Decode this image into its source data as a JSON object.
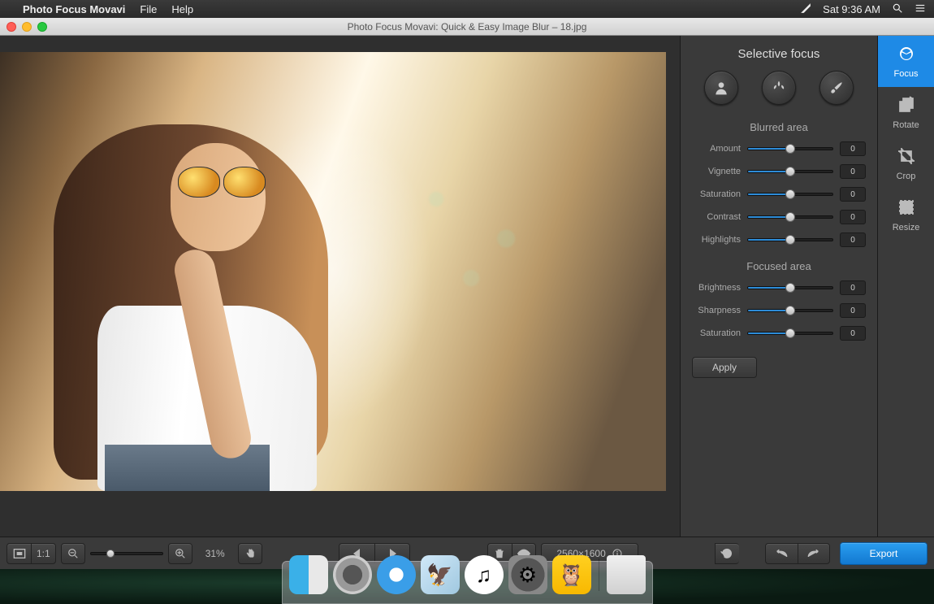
{
  "menubar": {
    "app_name": "Photo Focus Movavi",
    "items": [
      "File",
      "Help"
    ],
    "clock": "Sat 9:36 AM"
  },
  "window": {
    "title": "Photo Focus Movavi: Quick & Easy Image Blur – 18.jpg"
  },
  "panel": {
    "title": "Selective focus",
    "blurred_title": "Blurred area",
    "focused_title": "Focused area",
    "blurred": [
      {
        "label": "Amount",
        "value": 0,
        "pos": 50
      },
      {
        "label": "Vignette",
        "value": 0,
        "pos": 50
      },
      {
        "label": "Saturation",
        "value": 0,
        "pos": 50
      },
      {
        "label": "Contrast",
        "value": 0,
        "pos": 50
      },
      {
        "label": "Highlights",
        "value": 0,
        "pos": 50
      }
    ],
    "focused": [
      {
        "label": "Brightness",
        "value": 0,
        "pos": 50
      },
      {
        "label": "Sharpness",
        "value": 0,
        "pos": 50
      },
      {
        "label": "Saturation",
        "value": 0,
        "pos": 50
      }
    ],
    "apply_label": "Apply"
  },
  "tools": [
    {
      "key": "focus",
      "label": "Focus",
      "active": true
    },
    {
      "key": "rotate",
      "label": "Rotate",
      "active": false
    },
    {
      "key": "crop",
      "label": "Crop",
      "active": false
    },
    {
      "key": "resize",
      "label": "Resize",
      "active": false
    }
  ],
  "bottom": {
    "one_to_one": "1:1",
    "zoom_pct": "31%",
    "dimensions": "2560×1600",
    "export_label": "Export"
  },
  "dock": {
    "items": [
      "finder",
      "launchpad",
      "safari",
      "mail",
      "itunes",
      "settings",
      "owl"
    ],
    "trash": "trash"
  }
}
